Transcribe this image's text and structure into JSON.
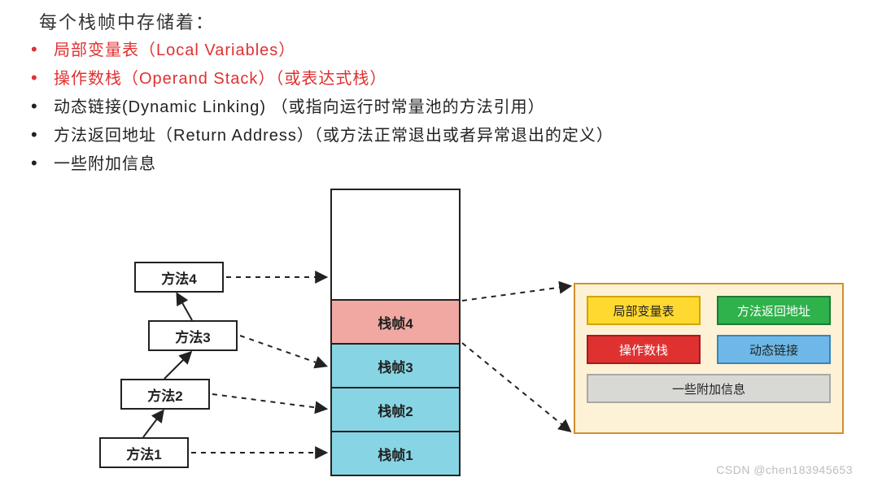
{
  "heading": "每个栈帧中存储着：",
  "bullets": [
    {
      "text": "局部变量表（Local Variables）",
      "highlight": true
    },
    {
      "text": "操作数栈（Operand Stack）（或表达式栈）",
      "highlight": true
    },
    {
      "text": "动态链接(Dynamic Linking) （或指向运行时常量池的方法引用）",
      "highlight": false
    },
    {
      "text": "方法返回地址（Return Address）（或方法正常退出或者异常退出的定义）",
      "highlight": false
    },
    {
      "text": "一些附加信息",
      "highlight": false
    }
  ],
  "methods": {
    "m1": "方法1",
    "m2": "方法2",
    "m3": "方法3",
    "m4": "方法4"
  },
  "frames": {
    "f1": "栈帧1",
    "f2": "栈帧2",
    "f3": "栈帧3",
    "f4": "栈帧4"
  },
  "panel": {
    "local_vars": "局部变量表",
    "return_addr": "方法返回地址",
    "operand_stack": "操作数栈",
    "dynamic_link": "动态链接",
    "extra": "一些附加信息"
  },
  "watermark": "CSDN @chen183945653"
}
